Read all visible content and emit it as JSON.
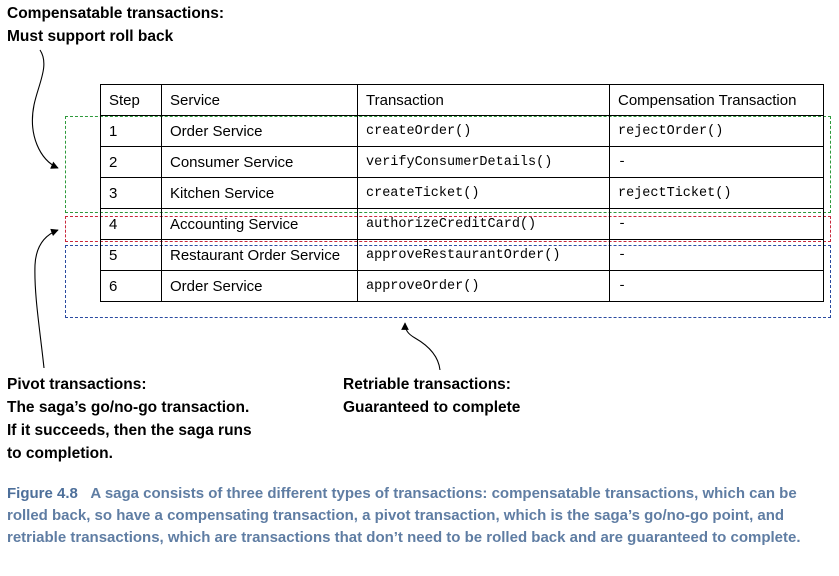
{
  "labels": {
    "compensatable": [
      "Compensatable transactions:",
      "Must support roll back"
    ],
    "pivot": [
      "Pivot transactions:",
      "The saga’s go/no-go transaction.",
      "If it succeeds, then the saga runs",
      "to completion."
    ],
    "retriable": [
      "Retriable transactions:",
      "Guaranteed to complete"
    ]
  },
  "table": {
    "headers": [
      "Step",
      "Service",
      "Transaction",
      "Compensation Transaction"
    ],
    "rows": [
      [
        "1",
        "Order Service",
        "createOrder()",
        "rejectOrder()"
      ],
      [
        "2",
        "Consumer Service",
        "verifyConsumerDetails()",
        "-"
      ],
      [
        "3",
        "Kitchen Service",
        "createTicket()",
        "rejectTicket()"
      ],
      [
        "4",
        "Accounting Service",
        "authorizeCreditCard()",
        "-"
      ],
      [
        "5",
        "Restaurant Order Service",
        "approveRestaurantOrder()",
        "-"
      ],
      [
        "6",
        "Order Service",
        "approveOrder()",
        "-"
      ]
    ]
  },
  "groups": {
    "compensatable_color": "#2e9a3c",
    "pivot_color": "#c8283c",
    "retriable_color": "#2a4aa0"
  },
  "caption": {
    "figure": "Figure 4.8",
    "text": "A saga consists of three different types of transactions: compensatable transactions, which can be rolled back, so have a compensating transaction, a pivot transaction, which is the saga’s go/no-go point, and retriable transactions, which are transactions that don’t need to be rolled back and are guaranteed to complete."
  }
}
